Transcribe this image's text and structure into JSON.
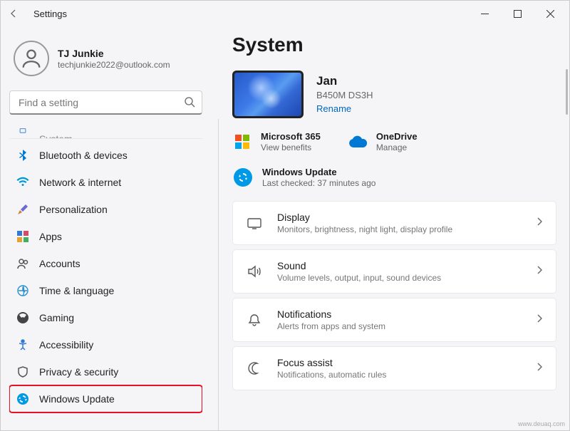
{
  "window": {
    "title": "Settings"
  },
  "user": {
    "name": "TJ Junkie",
    "email": "techjunkie2022@outlook.com"
  },
  "search": {
    "placeholder": "Find a setting"
  },
  "sidebar": {
    "cut_item": "System",
    "items": [
      {
        "label": "Bluetooth & devices"
      },
      {
        "label": "Network & internet"
      },
      {
        "label": "Personalization"
      },
      {
        "label": "Apps"
      },
      {
        "label": "Accounts"
      },
      {
        "label": "Time & language"
      },
      {
        "label": "Gaming"
      },
      {
        "label": "Accessibility"
      },
      {
        "label": "Privacy & security"
      },
      {
        "label": "Windows Update"
      }
    ]
  },
  "main": {
    "title": "System",
    "device": {
      "name": "Jan",
      "model": "B450M DS3H",
      "rename": "Rename"
    },
    "services": {
      "m365": {
        "title": "Microsoft 365",
        "sub": "View benefits"
      },
      "onedrive": {
        "title": "OneDrive",
        "sub": "Manage"
      }
    },
    "update": {
      "title": "Windows Update",
      "sub": "Last checked: 37 minutes ago"
    },
    "settings": [
      {
        "title": "Display",
        "sub": "Monitors, brightness, night light, display profile"
      },
      {
        "title": "Sound",
        "sub": "Volume levels, output, input, sound devices"
      },
      {
        "title": "Notifications",
        "sub": "Alerts from apps and system"
      },
      {
        "title": "Focus assist",
        "sub": "Notifications, automatic rules"
      }
    ]
  },
  "watermark": "www.deuaq.com"
}
